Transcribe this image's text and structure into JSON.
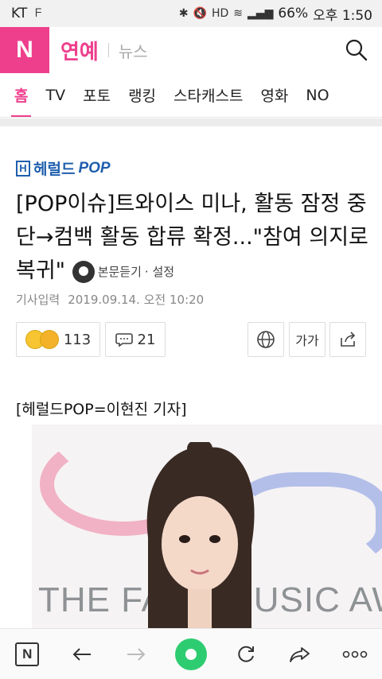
{
  "status_bar": {
    "carrier": "KT",
    "battery": "66%",
    "time": "오후 1:50"
  },
  "header": {
    "logo": "N",
    "section": "연예",
    "subsection": "뉴스"
  },
  "tabs": [
    "홈",
    "TV",
    "포토",
    "랭킹",
    "스타캐스트",
    "영화",
    "NO"
  ],
  "article": {
    "press": {
      "name": "헤럴드",
      "pop": "POP"
    },
    "headline": "[POP이슈]트와이스 미나, 활동 잠정 중단→컴백 활동 합류 확정...\"참여 의지로 복귀\"",
    "listen_label": "본문듣기",
    "settings_label": "· 설정",
    "meta_label": "기사입력",
    "meta_date": "2019.09.14. 오전 10:20",
    "reactions_count": "113",
    "comments_count": "21",
    "font_label": "가가",
    "reporter": "[헤럴드POP=이현진 기자]"
  },
  "photo": {
    "backdrop_text": "THE FACT MUSIC AWARD"
  },
  "colors": {
    "accent": "#ee3f8d",
    "press": "#1f5fae",
    "green": "#2ecc71"
  }
}
